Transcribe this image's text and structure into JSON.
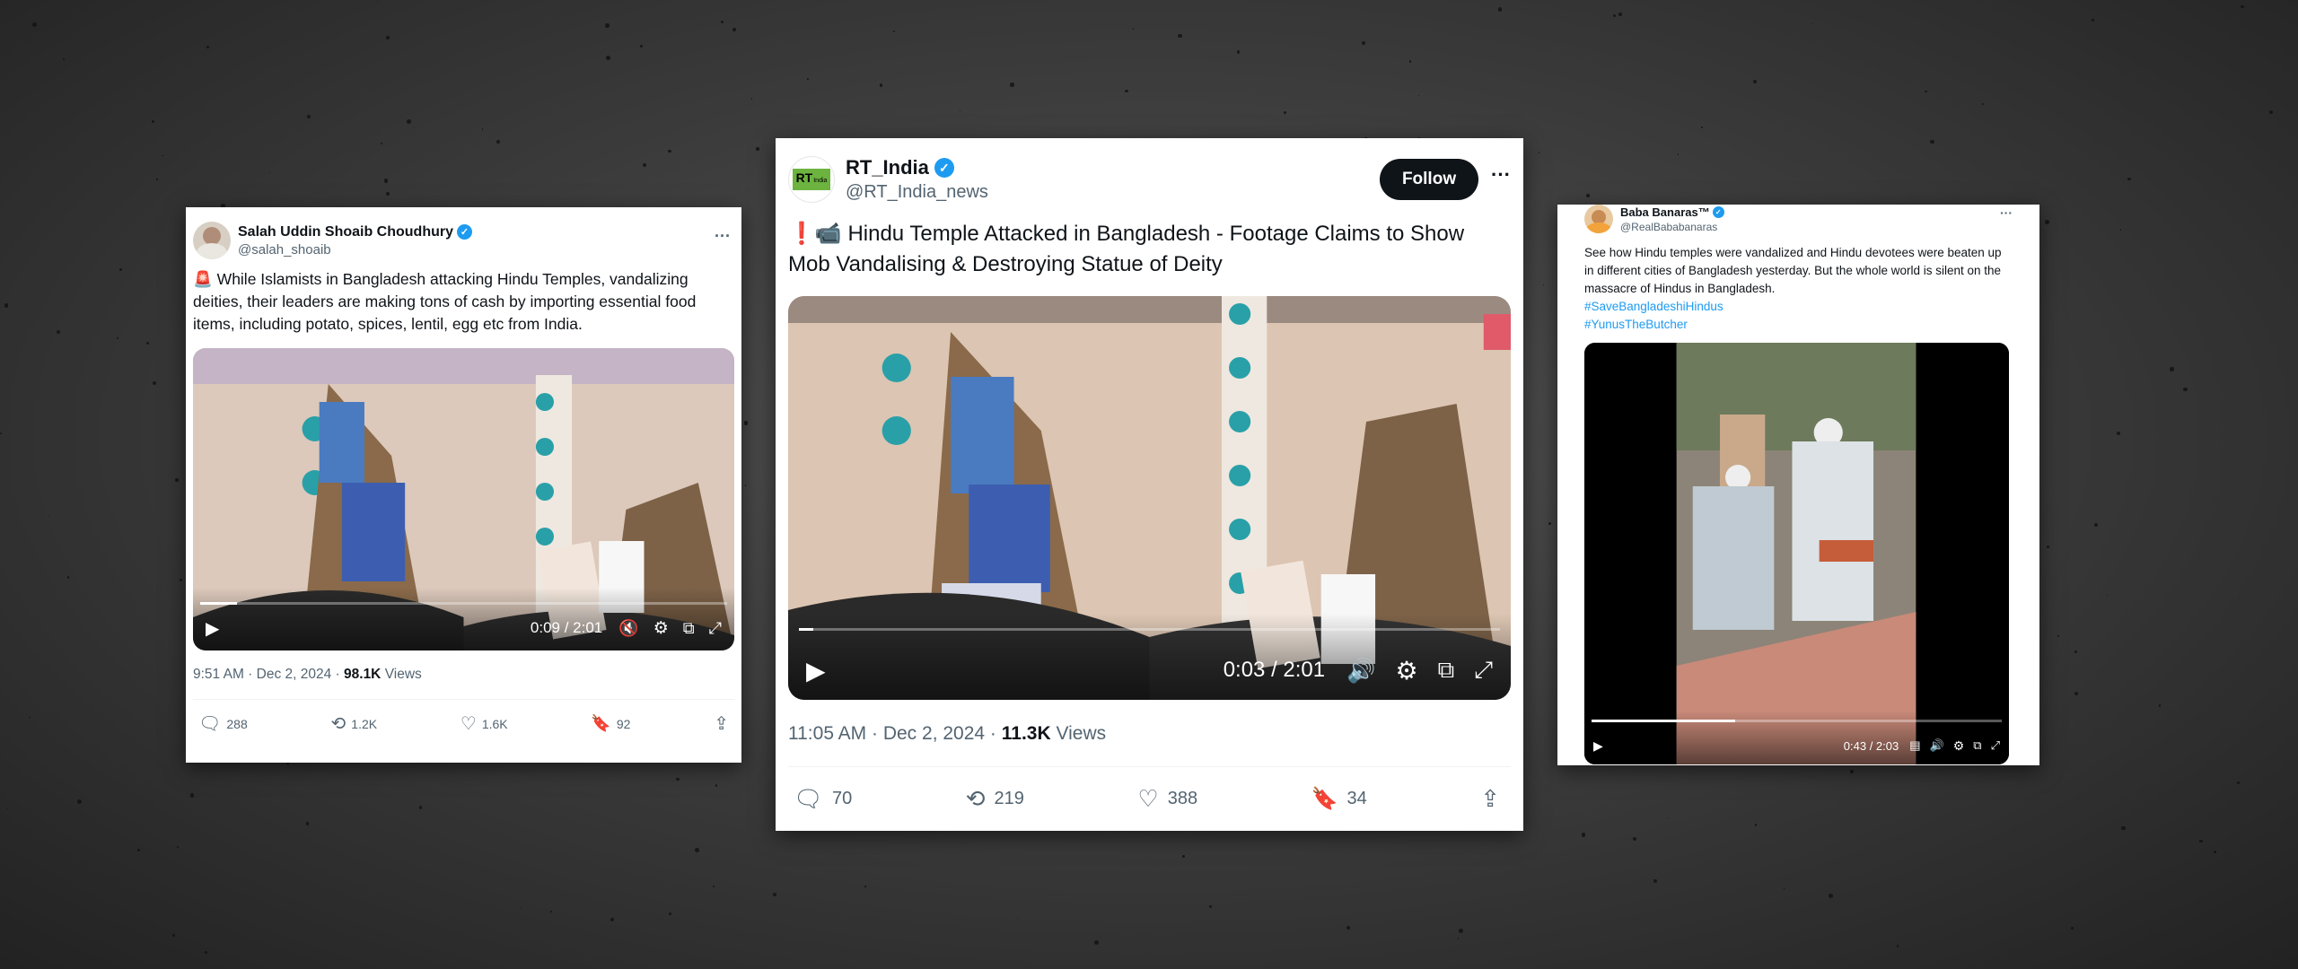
{
  "left_tweet": {
    "author_name": "Salah Uddin Shoaib Choudhury",
    "handle": "@salah_shoaib",
    "more_label": "···",
    "emoji": "🚨",
    "text": "While Islamists in Bangladesh attacking Hindu Temples, vandalizing deities, their leaders are making tons of cash by importing essential food items, including potato, spices, lentil, egg etc from India.",
    "video_time": "0:09 / 2:01",
    "video_progress": 0.07,
    "meta_time": "9:51 AM · Dec 2, 2024 · ",
    "views_count": "98.1K",
    "views_label": " Views",
    "replies": "288",
    "reposts": "1.2K",
    "likes": "1.6K",
    "bookmarks": "92"
  },
  "center_tweet": {
    "author_name": "RT_India",
    "handle": "@RT_India_news",
    "logo_text": "RT",
    "logo_sub": "India",
    "follow_label": "Follow",
    "more_label": "···",
    "emoji": "❗📹",
    "text": "Hindu Temple Attacked in Bangladesh - Footage Claims to Show Mob Vandalising & Destroying Statue of Deity",
    "video_time": "0:03 / 2:01",
    "video_progress": 0.02,
    "meta_time": "11:05 AM · Dec 2, 2024 · ",
    "views_count": "11.3K",
    "views_label": " Views",
    "replies": "70",
    "reposts": "219",
    "likes": "388",
    "bookmarks": "34"
  },
  "right_tweet": {
    "author_name": "Baba Banaras™",
    "handle": "@RealBababanaras",
    "more_label": "···",
    "text": "See how Hindu temples were vandalized and Hindu devotees were beaten up in different cities of Bangladesh yesterday. But the whole world is silent on the massacre of Hindus in Bangladesh.",
    "hashtag1": "#SaveBangladeshiHindus",
    "hashtag2": "#YunusTheButcher",
    "video_time": "0:43 / 2:03",
    "video_progress": 0.35
  },
  "colors": {
    "accent": "#1d9bf0",
    "text": "#0f1419",
    "muted": "#536471",
    "background": "#3a3a3a"
  }
}
